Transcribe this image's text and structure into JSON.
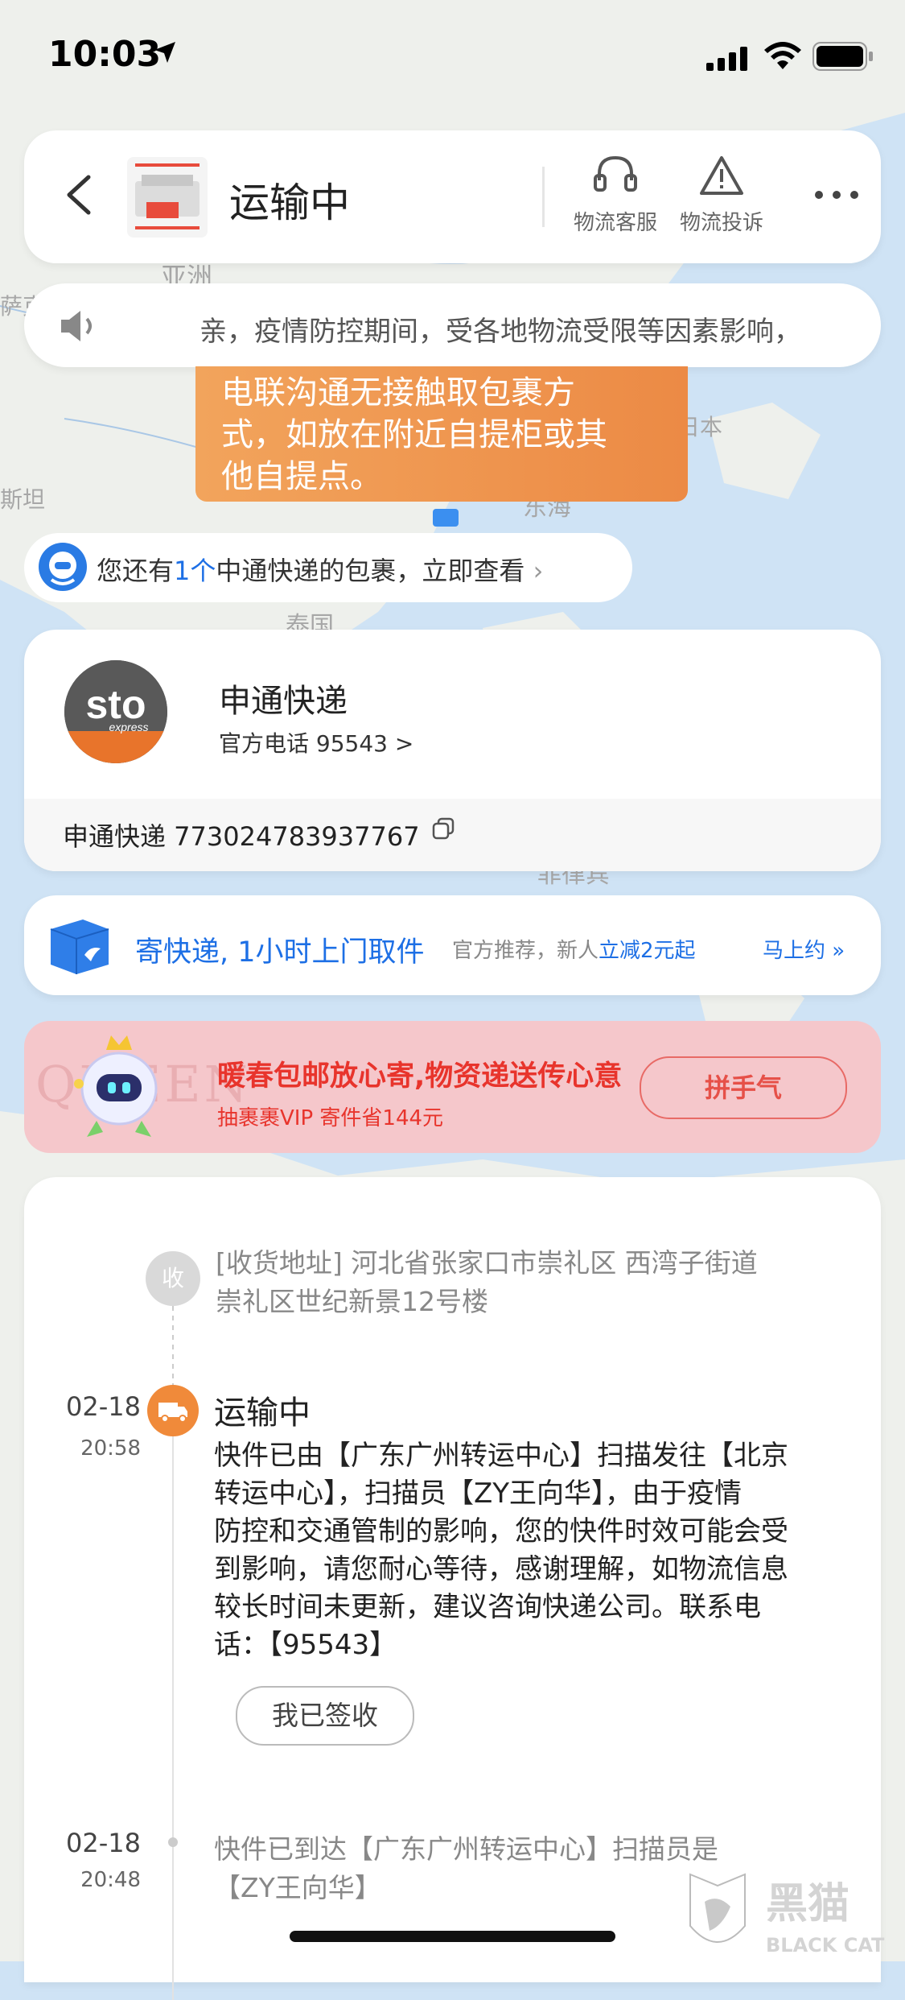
{
  "status_bar": {
    "time": "10:03"
  },
  "header": {
    "title": "运输中",
    "service_label": "物流客服",
    "complaint_label": "物流投诉"
  },
  "notice": {
    "text": "亲，疫情防控期间，受各地物流受限等因素影响，"
  },
  "tooltip": {
    "lines": [
      "电联沟通无接触取包裹方",
      "式，如放在附近自提柜或其",
      "他自提点。"
    ]
  },
  "map_labels": [
    "亚洲",
    "萨克",
    "斯坦",
    "日本",
    "东海",
    "泰国",
    "菲律宾"
  ],
  "package_prompt": {
    "prefix": "您还有",
    "count": "1个",
    "suffix": "中通快递的包裹，立即查看"
  },
  "courier": {
    "name": "申通快递",
    "phone": "官方电话 95543 >",
    "tracking": "申通快递 773024783937767",
    "logo_text": "sto",
    "logo_sub": "express"
  },
  "send_banner": {
    "main": "寄快递, 1小时上门取件",
    "sub_prefix": "官方推荐，新人",
    "sub_highlight": "立减2元起",
    "cta": "马上约"
  },
  "promo": {
    "watermark": "QUEEN",
    "title": "暖春包邮放心寄,物资递送传心意",
    "subtitle": "抽裹裹VIP 寄件省144元",
    "button": "拼手气"
  },
  "timeline": {
    "receive_badge": "收",
    "address_lines": [
      "[收货地址] 河北省张家口市崇礼区  西湾子街道",
      "崇礼区世纪新景12号楼"
    ],
    "event1": {
      "date": "02-18",
      "time": "20:58",
      "title": "运输中",
      "lines": [
        "快件已由【广东广州转运中心】扫描发往【北京",
        "转运中心】，扫描员【ZY王向华】，由于疫情",
        "防控和交通管制的影响，您的快件时效可能会受",
        "到影响，请您耐心等待，感谢理解，如物流信息",
        "较长时间未更新，建议咨询快递公司。联系电",
        "话：【95543】"
      ],
      "sign_button": "我已签收"
    },
    "event2": {
      "date": "02-18",
      "time": "20:48",
      "lines": [
        "快件已到达【广东广州转运中心】扫描员是",
        "【ZY王向华】"
      ]
    }
  },
  "watermark_brand": {
    "cn": "黑猫",
    "en": "BLACK CAT"
  },
  "colors": {
    "accent_blue": "#1d6fe5",
    "orange": "#f08a3a",
    "promo_red": "#e8342c"
  }
}
